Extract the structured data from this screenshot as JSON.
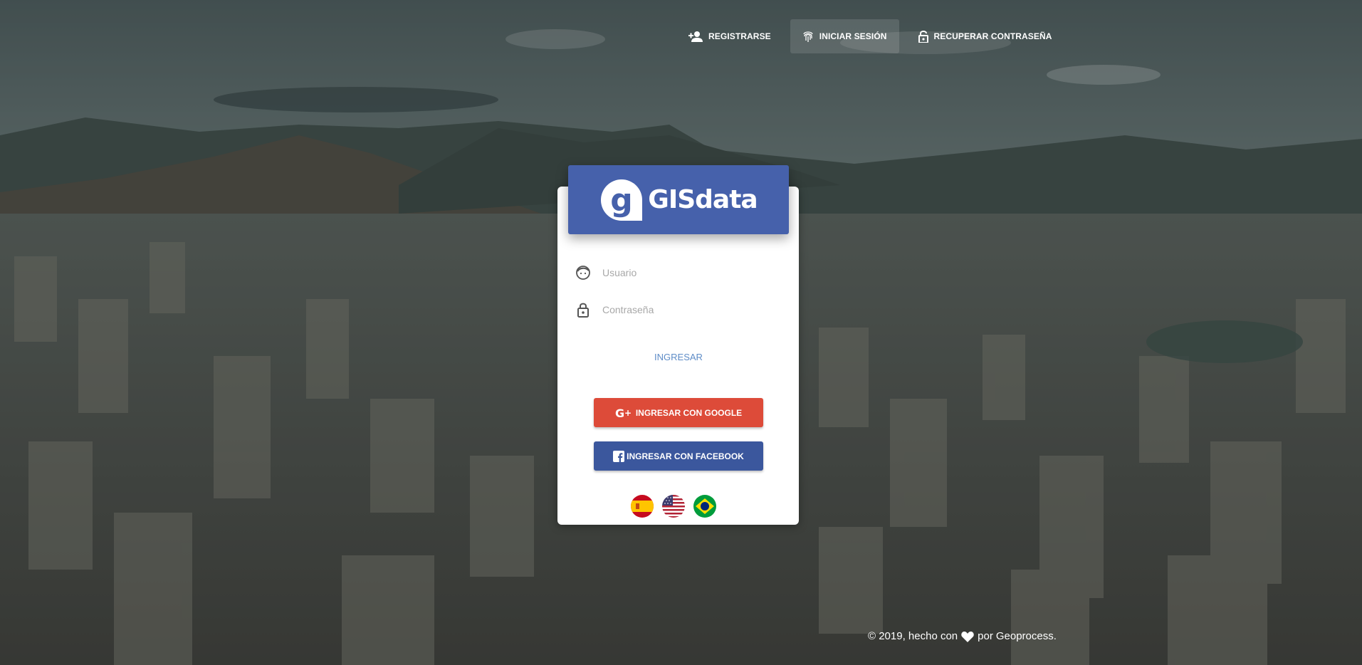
{
  "nav": {
    "register": "REGISTRARSE",
    "login": "INICIAR SESIÓN",
    "recover": "RECUPERAR CONTRASEÑA"
  },
  "brand": {
    "logo_text": "GISdata"
  },
  "form": {
    "user_placeholder": "Usuario",
    "password_placeholder": "Contraseña",
    "submit_label": "INGRESAR",
    "google_label": "INGRESAR CON GOOGLE",
    "facebook_label": "INGRESAR CON FACEBOOK"
  },
  "languages": [
    "es",
    "en",
    "pt"
  ],
  "footer": {
    "text_before": "© 2019, hecho con",
    "text_after": "por",
    "company": "Geoprocess."
  },
  "colors": {
    "header": "#4661ab",
    "google": "#dd4b39",
    "facebook": "#3b579d",
    "link": "#5e8cc7"
  }
}
